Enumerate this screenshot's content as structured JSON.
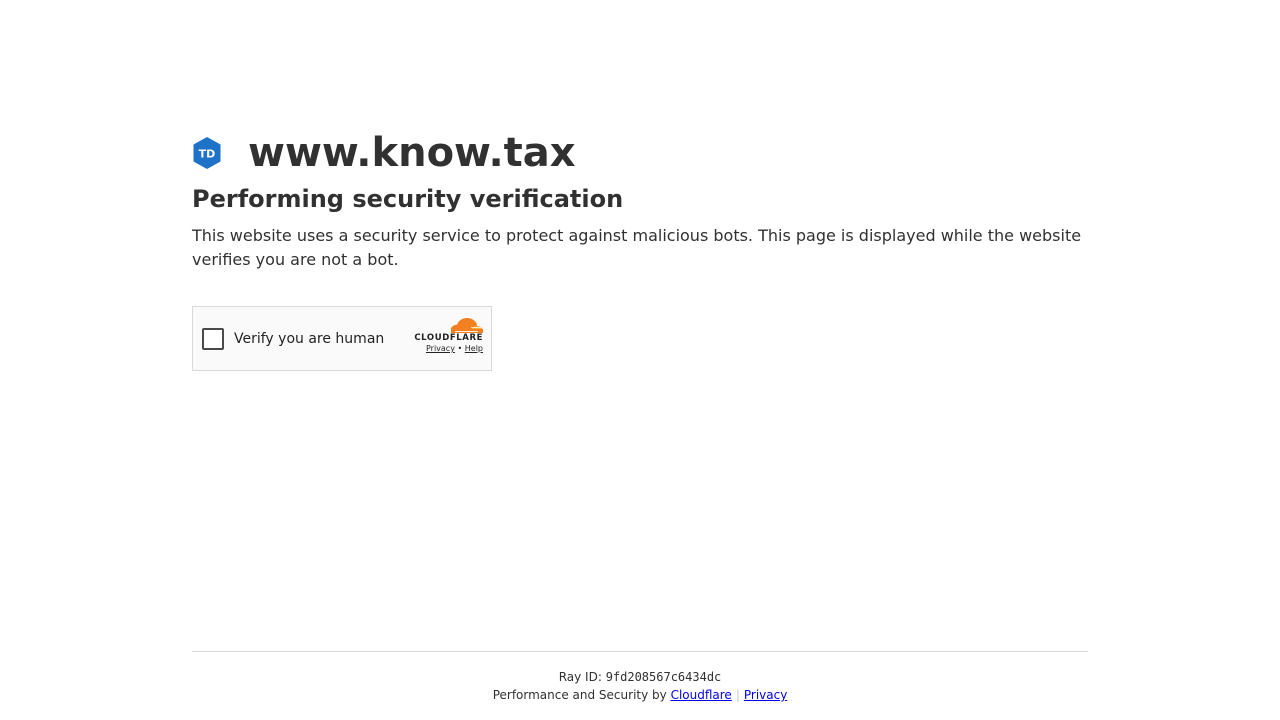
{
  "site": {
    "logo_text": "TD",
    "name": "www.know.tax"
  },
  "main": {
    "heading": "Performing security verification",
    "description": "This website uses a security service to protect against malicious bots. This page is displayed while the website verifies you are not a bot."
  },
  "widget": {
    "checkbox_label": "Verify you are human",
    "brand": "CLOUDFLARE",
    "privacy_link": "Privacy",
    "separator": "•",
    "help_link": "Help"
  },
  "footer": {
    "ray_label": "Ray ID: ",
    "ray_id": "9fd208567c6434dc",
    "perf_text": "Performance and Security by ",
    "cloudflare_link": "Cloudflare",
    "divider": "|",
    "privacy_link": "Privacy"
  },
  "colors": {
    "logo_blue": "#1e72c8",
    "cloudflare_orange": "#f38020",
    "link_blue": "#0000ee"
  }
}
